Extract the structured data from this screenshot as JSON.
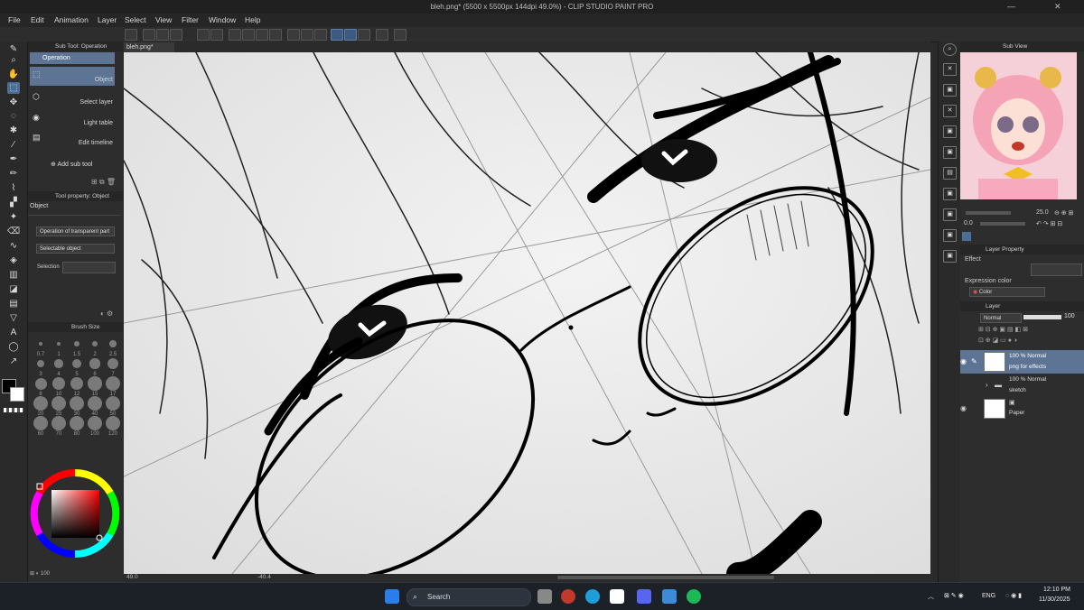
{
  "window": {
    "title": "bleh.png* (5500 x 5500px 144dpi 49.0%) - CLIP STUDIO PAINT PRO",
    "controls": {
      "minimize": "—",
      "close": "✕"
    }
  },
  "menu": [
    "File",
    "Edit",
    "Animation",
    "Layer",
    "Select",
    "View",
    "Filter",
    "Window",
    "Help"
  ],
  "sub_tool_panel": {
    "title": "Sub Tool: Operation",
    "group": "Operation",
    "items": [
      "Object",
      "Select layer",
      "Light table",
      "Edit timeline"
    ],
    "add_label": "Add sub tool"
  },
  "tool_property": {
    "title": "Tool property: Object",
    "heading": "Object",
    "dropdown1": "Operation of transparent part",
    "dropdown2": "Selectable object",
    "selection_label": "Selection"
  },
  "brush_size": {
    "title": "Brush Size",
    "sizes": [
      "0.7",
      "1",
      "1.5",
      "2",
      "2.5",
      "3",
      "4",
      "5",
      "6",
      "7",
      "8",
      "10",
      "12",
      "15",
      "17",
      "20",
      "25",
      "30",
      "40",
      "50",
      "60",
      "70",
      "80",
      "100",
      "120"
    ]
  },
  "color_bottom": {
    "value": "100"
  },
  "canvas": {
    "tab": "bleh.png*",
    "zoom": "49.0",
    "angle": "-40.4"
  },
  "sub_view": {
    "title": "Sub View",
    "zoom": "25.0",
    "rotation": "0.0"
  },
  "layer_property": {
    "title": "Layer Property",
    "effect_label": "Effect",
    "expression_label": "Expression color",
    "expression_value": "Color"
  },
  "layer_panel": {
    "title": "Layer",
    "blend": "Normal",
    "opacity": "100",
    "layers": [
      {
        "mode": "100 % Normal",
        "name": "png for effects",
        "selected": true
      },
      {
        "mode": "100 % Normal",
        "name": "sketch",
        "selected": false
      },
      {
        "mode": "",
        "name": "Paper",
        "selected": false
      }
    ]
  },
  "taskbar": {
    "search": "Search",
    "lang": "ENG",
    "time": "12:10 PM",
    "date": "11/30/2025"
  },
  "colors": {
    "accent": "#5d7494",
    "selected_tool": "#4a6e96",
    "canvas_bg": "#ececec"
  }
}
